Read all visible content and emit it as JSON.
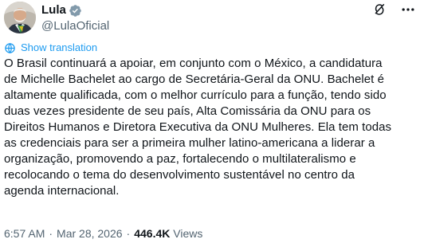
{
  "author": {
    "display_name": "Lula",
    "handle": "@LulaOficial",
    "avatar_icon": "user-avatar",
    "verified_icon": "verified-badge-icon",
    "verified_color": "#829aab"
  },
  "actions": {
    "grok_icon": "grok-icon",
    "more_icon": "more-options-icon"
  },
  "translation": {
    "label": "Show translation",
    "icon": "globe-icon",
    "color": "#1d9bf0"
  },
  "tweet": {
    "text": "O Brasil continuará a apoiar, em conjunto com o México, a candidatura\nde Michelle Bachelet ao cargo de Secretária-Geral da ONU. Bachelet é\naltamente qualificada, com o melhor currículo para a função, tendo sido\nduas vezes presidente de seu país, Alta Comissária da ONU para os\nDireitos Humanos e Diretora Executiva da ONU Mulheres. Ela tem todas\nas credenciais para ser a primeira mulher latino-americana a liderar a\norganização, promovendo a paz, fortalecendo o multilateralismo e\nrecolocando o tema do desenvolvimento sustentável no centro da\nagenda internacional."
  },
  "meta": {
    "time": "6:57 AM",
    "separator": "·",
    "date": "Mar 28, 2026",
    "views_count": "446.4K",
    "views_label": "Views"
  },
  "colors": {
    "text": "#0f1419",
    "secondary": "#536471",
    "accent": "#1d9bf0"
  }
}
